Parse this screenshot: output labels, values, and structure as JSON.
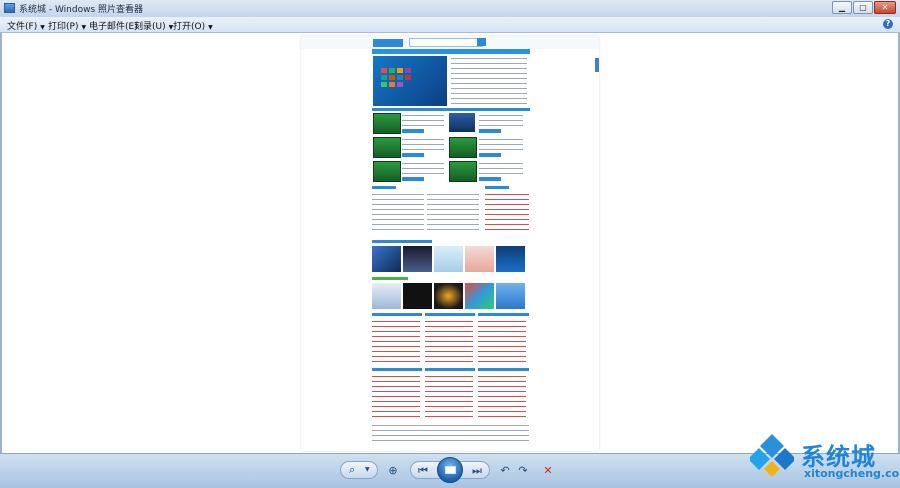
{
  "window": {
    "title": "系统城 - Windows 照片查看器",
    "minimize_label": "▁",
    "maximize_label": "▢",
    "close_label": "✕"
  },
  "menu": {
    "items": [
      {
        "label": "文件(F)"
      },
      {
        "label": "打印(P)"
      },
      {
        "label": "电子邮件(E)"
      },
      {
        "label": "刻录(U)"
      },
      {
        "label": "打开(O)"
      }
    ],
    "help_label": "?"
  },
  "toolbar": {
    "zoom_icon": "⌕",
    "fit_icon": "⊕",
    "prev_icon": "⏮",
    "next_icon": "⏭",
    "rotate_ccw_icon": "↶",
    "rotate_cw_icon": "↷",
    "delete_icon": "✕"
  },
  "watermark": {
    "brand": "系统城",
    "url": "xitongcheng.com"
  },
  "colors": {
    "accent": "#1f86d6",
    "toolbar_bg": "#b9cde0",
    "delete": "#cc2a1e"
  }
}
